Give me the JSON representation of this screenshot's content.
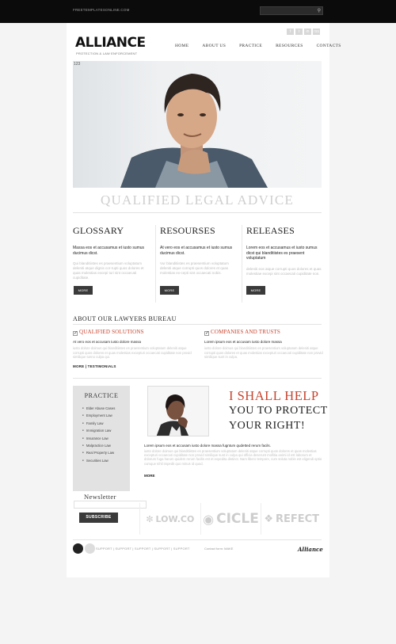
{
  "topbar": {
    "url_text": "FREETEMPLATESONLINE.COM",
    "search_placeholder": "",
    "search_icon": "search-icon"
  },
  "brand": {
    "logo": "ALLIANCE",
    "tagline": "PROTECTION & LAW ENFORCEMENT"
  },
  "social": [
    "f",
    "t",
    "in",
    "rss"
  ],
  "nav": [
    "HOME",
    "ABOUT US",
    "PRACTICE",
    "RESOURCES",
    "CONTACTS"
  ],
  "hero": {
    "page_number": "123",
    "title": "QUALIFIED LEGAL ADVICE"
  },
  "columns": [
    {
      "title": "GLOSSARY",
      "lead": "Massa eos et accusamus et iusto sumus ducimus dicst.",
      "body": "Qui blanditiistes es praesentium voluptatum deleniti atque dignis cor-rupti quos dolores et quas molestias excepi turi sint occaecati cupiditate.",
      "button": "MORE"
    },
    {
      "title": "RESOURSES",
      "lead": "At vero eos et accusamus et iusto sumus ducimus dicst.",
      "body": "Vur blanditiistes es praesentium voluptatum deleniti atque corrupti quos dolores et quas molestias ex-cepti sint occaecati nobis.",
      "button": "MORE"
    },
    {
      "title": "RELEASES",
      "lead": "Lorem eos et accusamus et iusto sumus dicst qui blanditiistes es praesent voluptatum",
      "body": "deleniti eos atque corrupti quos dolores et quas molestiae excepi sint occaecati cupiditate non.",
      "button": "MORE"
    }
  ],
  "about": {
    "title": "ABOUT OUR LAWYERS BUREAU",
    "items": [
      {
        "title": "QUALIFIED SOLUTIONS",
        "lead": "At vero eos et accusam iusto dolore massa",
        "body": "iusto dolore doimus qui blanditiistes es praesentium voluptatum deleniti atque corrupti quos dolores et quas molestias excepturi occaecati cupiditate non provid similique tunno culpa qui."
      },
      {
        "title": "COMPANIES AND TRUSTS",
        "lead": "Lorem ipsum eos et accusam iusto dolore massa",
        "body": "iusto dolore doimus qui blanditiistes es praesentium voluptatum deleniti atque corrupti quos dolores et quas molestias excepturi occaecati cupiditate non provid similique sunt in culpa."
      }
    ],
    "more_link": "MORE | TESTIMONIALS"
  },
  "practice": {
    "title": "PRACTICE",
    "items": [
      "Elder Abuse Cases",
      "Employment Law",
      "Family Law",
      "Immigration Law",
      "Insurance Law",
      "Malpractice Law",
      "Real Property Law",
      "Securities Law"
    ]
  },
  "newsletter": {
    "title": "Newsletter",
    "button": "SUBSCRIBE"
  },
  "help": {
    "line1": "I SHALL HELP",
    "line2": "YOU TO PROTECT",
    "line3": "YOUR RIGHT!",
    "lead": "Lorem ipsum eos et accusam iusto dolore massa fugntum qudetted rerum facils.",
    "body": "iusto dolore doimus qui blanditiistes es praesentium voluptatum deleniti atque corrupti quos dolores et quas molestias excepturi occaecati cupiditate non provid similique sunt in culpa qui officia deserunt mollitia animi id est laborum et dolorum fuga harum quidem rerum facilis est et expedita distinct. Nam libero tempore, cum soluta nobis est eligendi optio cumque nihil impedit quo minus id quod.",
    "more": "MORE"
  },
  "partners": [
    "LOW.CO",
    "CICLE",
    "REFECT"
  ],
  "footer": {
    "links": "SUPPORT  |  SUPPORT  |  SUPPORT  |  SUPPORT  |  SUPPORT",
    "contact": "Contact form: MAKE",
    "logo": "Alliance"
  }
}
